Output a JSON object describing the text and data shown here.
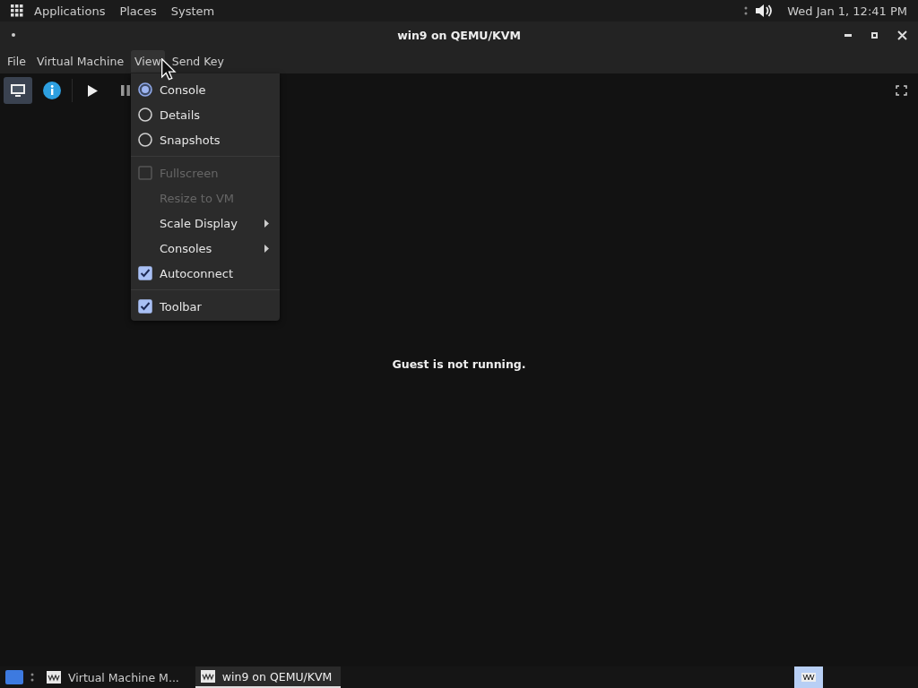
{
  "top_panel": {
    "menus": [
      "Applications",
      "Places",
      "System"
    ],
    "clock": "Wed Jan  1, 12:41 PM"
  },
  "window": {
    "title": "win9 on QEMU/KVM"
  },
  "menubar": [
    {
      "label": "File",
      "selected": false
    },
    {
      "label": "Virtual Machine",
      "selected": false
    },
    {
      "label": "View",
      "selected": true
    },
    {
      "label": "Send Key",
      "selected": false
    }
  ],
  "toolbar": {
    "console_selected": true
  },
  "view_menu": {
    "sections": [
      [
        {
          "kind": "radio",
          "label": "Console",
          "selected": true,
          "disabled": false
        },
        {
          "kind": "radio",
          "label": "Details",
          "selected": false,
          "disabled": false
        },
        {
          "kind": "radio",
          "label": "Snapshots",
          "selected": false,
          "disabled": false
        }
      ],
      [
        {
          "kind": "check",
          "label": "Fullscreen",
          "checked": false,
          "disabled": true
        },
        {
          "kind": "plain",
          "label": "Resize to VM",
          "disabled": true
        },
        {
          "kind": "submenu",
          "label": "Scale Display",
          "disabled": false
        },
        {
          "kind": "submenu",
          "label": "Consoles",
          "disabled": false
        },
        {
          "kind": "check",
          "label": "Autoconnect",
          "checked": true,
          "disabled": false
        }
      ],
      [
        {
          "kind": "check",
          "label": "Toolbar",
          "checked": true,
          "disabled": false
        }
      ]
    ]
  },
  "message": "Guest is not running.",
  "taskbar": {
    "tasks": [
      {
        "label": "Virtual Machine M...",
        "selected": false
      },
      {
        "label": "win9 on QEMU/KVM",
        "selected": true
      }
    ]
  }
}
